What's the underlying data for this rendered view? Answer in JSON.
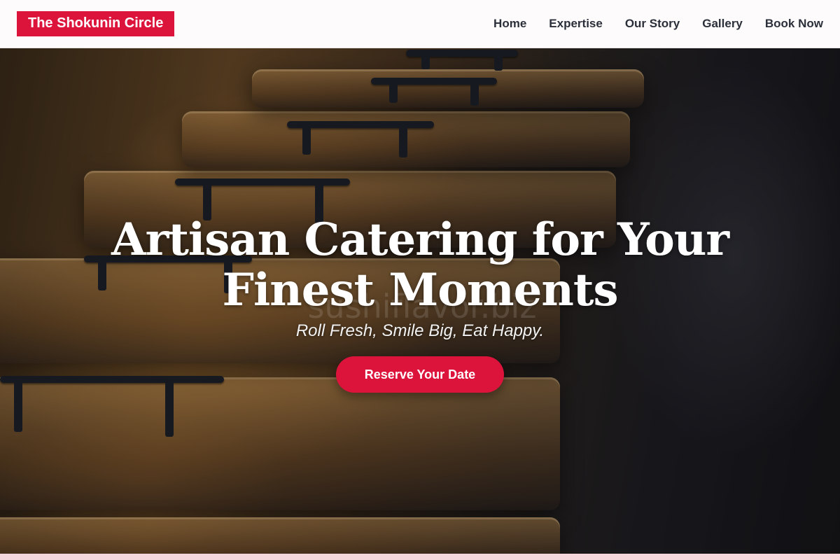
{
  "header": {
    "brand": "The Shokunin Circle",
    "nav": [
      {
        "label": "Home"
      },
      {
        "label": "Expertise"
      },
      {
        "label": "Our Story"
      },
      {
        "label": "Gallery"
      },
      {
        "label": "Book Now"
      }
    ]
  },
  "hero": {
    "title": "Artisan Catering for Your Finest Moments",
    "subtitle": "Roll Fresh, Smile Big, Eat Happy.",
    "cta_label": "Reserve Your Date",
    "watermark": "sushiflavor.biz",
    "background_image": "chafing-dishes-photo"
  },
  "colors": {
    "accent": "#dc143c",
    "nav_text": "#2b2f3a",
    "header_bg": "#fdfbfb",
    "footer_strip": "#f4d7dc"
  }
}
